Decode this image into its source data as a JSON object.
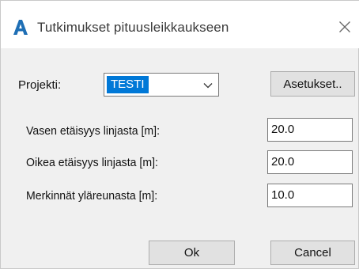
{
  "window": {
    "title": "Tutkimukset pituusleikkaukseen",
    "icon": "autocad-a-icon",
    "close_icon": "close-icon"
  },
  "project": {
    "label": "Projekti:",
    "selected": "TESTI",
    "settings_button": "Asetukset.."
  },
  "fields": {
    "left_distance": {
      "label": "Vasen etäisyys linjasta [m]:",
      "value": "20.0"
    },
    "right_distance": {
      "label": "Oikea etäisyys linjasta [m]:",
      "value": "20.0"
    },
    "marks_from_top": {
      "label": "Merkinnät yläreunasta [m]:",
      "value": "10.0"
    }
  },
  "buttons": {
    "ok": "Ok",
    "cancel": "Cancel"
  },
  "colors": {
    "accent": "#0078d7",
    "icon_blue": "#1f6fb5"
  }
}
